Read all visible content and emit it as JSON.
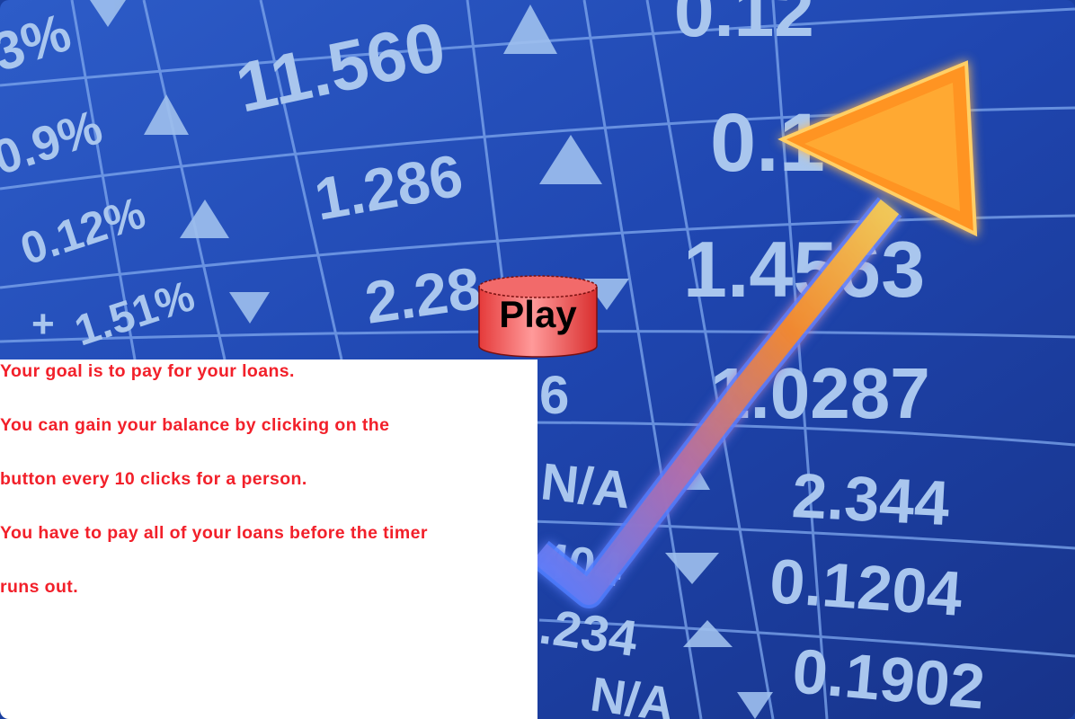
{
  "background": {
    "board_numbers": [
      "11.560",
      "1.286",
      "2.28",
      "0.168",
      "1.4563",
      "1.0287",
      "2.344",
      "0.1204",
      "0.1902",
      "3%",
      "0.9%",
      "0.12%",
      "1.51%",
      "+",
      "0.12",
      "6",
      "N/A",
      "N/A",
      "404",
      ".234"
    ],
    "colors": {
      "board_base": "#1a3fa0",
      "grid_line": "#7fa8ee",
      "arrow_orange": "#ff9a1f",
      "arrow_blue_trail": "#4d7dff"
    }
  },
  "play_button": {
    "label": "Play",
    "color": "#f04646"
  },
  "instructions": {
    "lines": [
      "Your goal is to pay for your loans.",
      "You can gain your balance by clicking on the",
      "button every 10 clicks for a person.",
      "You have to pay all of your loans before the timer",
      "runs out."
    ],
    "text_color": "#f2202a"
  }
}
